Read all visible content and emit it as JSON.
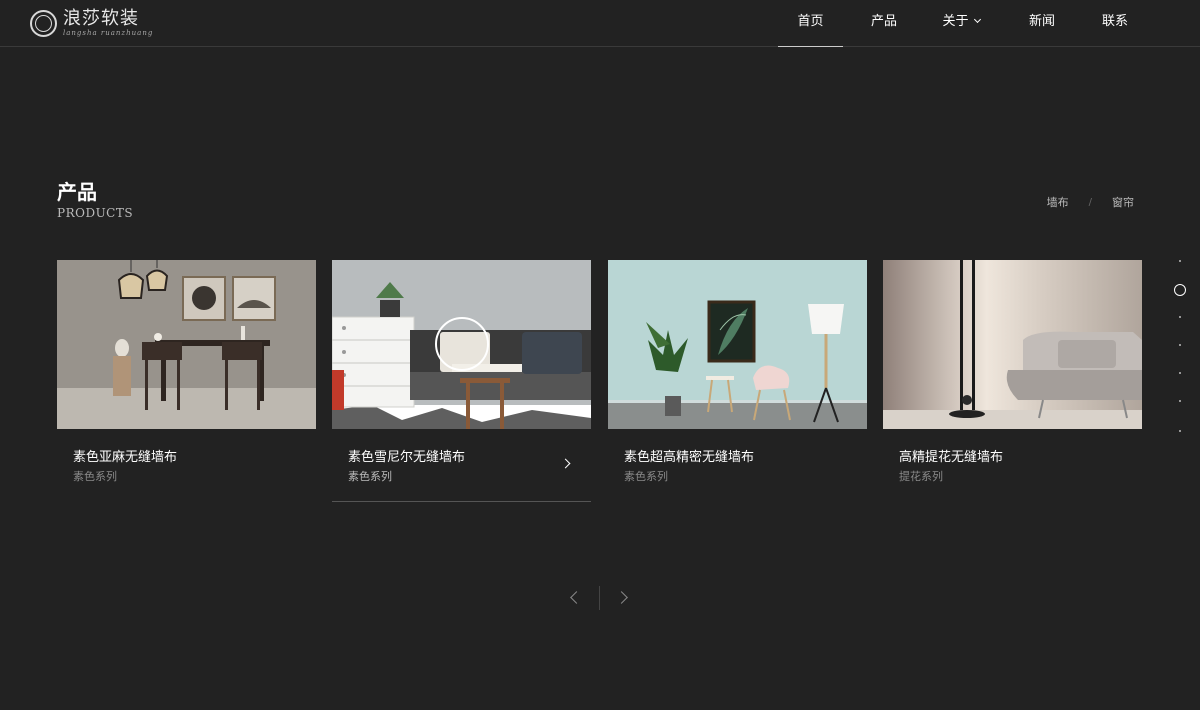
{
  "brand": {
    "name_cn": "浪莎软装",
    "name_en": "langsha ruanzhuang"
  },
  "nav": {
    "items": [
      {
        "label": "首页",
        "active": true
      },
      {
        "label": "产品",
        "active": false
      },
      {
        "label": "关于",
        "active": false,
        "dropdown": true
      },
      {
        "label": "新闻",
        "active": false
      },
      {
        "label": "联系",
        "active": false
      }
    ]
  },
  "section": {
    "title": "产品",
    "subtitle": "PRODUCTS"
  },
  "filters": {
    "items": [
      "墙布",
      "窗帘"
    ],
    "separator": "/"
  },
  "products": [
    {
      "name": "素色亚麻无缝墙布",
      "category": "素色系列",
      "scene": "dining-room"
    },
    {
      "name": "素色雪尼尔无缝墙布",
      "category": "素色系列",
      "scene": "living-room-sofa",
      "active": true
    },
    {
      "name": "素色超高精密无缝墙布",
      "category": "素色系列",
      "scene": "mint-room"
    },
    {
      "name": "高精提花无缝墙布",
      "category": "提花系列",
      "scene": "lounge"
    }
  ],
  "colors": {
    "background": "#222222",
    "text": "#ffffff",
    "muted": "#8a8a8a"
  }
}
